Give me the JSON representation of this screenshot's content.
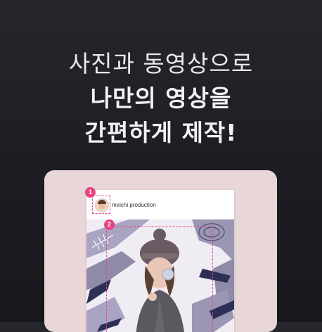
{
  "headline": {
    "line1": "사진과 동영상으로",
    "line2": "나만의 영상을",
    "line3": "간편하게 제작!"
  },
  "post": {
    "profile_name": "meichi production",
    "avatar_icon": "avatar-icon",
    "marker_1": "1",
    "marker_2": "2"
  },
  "colors": {
    "background": "#1c1d22",
    "card": "#e8d6d8",
    "accent_pink": "#e8437f",
    "art_lavender": "#8f8aa8",
    "art_navy": "#2d2f55"
  }
}
